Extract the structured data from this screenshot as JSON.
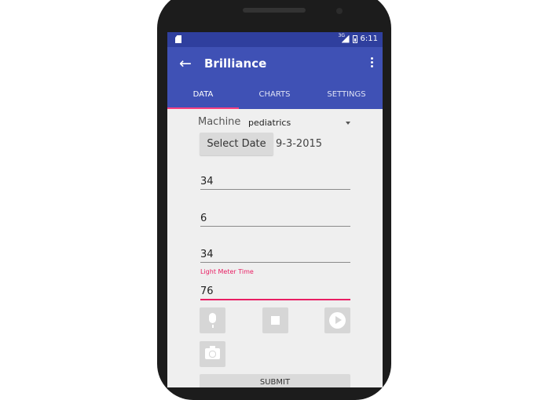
{
  "status_bar": {
    "network": "3G",
    "time": "6:11"
  },
  "app_bar": {
    "back_icon": "arrow-back-icon",
    "title": "Brilliance",
    "menu_icon": "more-vert-icon"
  },
  "tabs": [
    {
      "label": "DATA",
      "active": true
    },
    {
      "label": "CHARTS",
      "active": false
    },
    {
      "label": "SETTINGS",
      "active": false
    }
  ],
  "form": {
    "machine_label": "Machine",
    "machine_value": "pediatrics",
    "select_date_label": "Select Date",
    "date_value": "9-3-2015",
    "fields": [
      {
        "value": "34"
      },
      {
        "value": "6"
      },
      {
        "value": "34"
      },
      {
        "value": "76",
        "hint": "Light Meter Time",
        "focused": true
      }
    ],
    "action_icons": [
      "microphone-icon",
      "stop-icon",
      "play-icon",
      "camera-icon"
    ],
    "submit_label": "SUBMIT"
  },
  "colors": {
    "primary": "#3f51b5",
    "primary_dark": "#2f3f9e",
    "accent": "#ff4081",
    "focus": "#e91e63"
  }
}
